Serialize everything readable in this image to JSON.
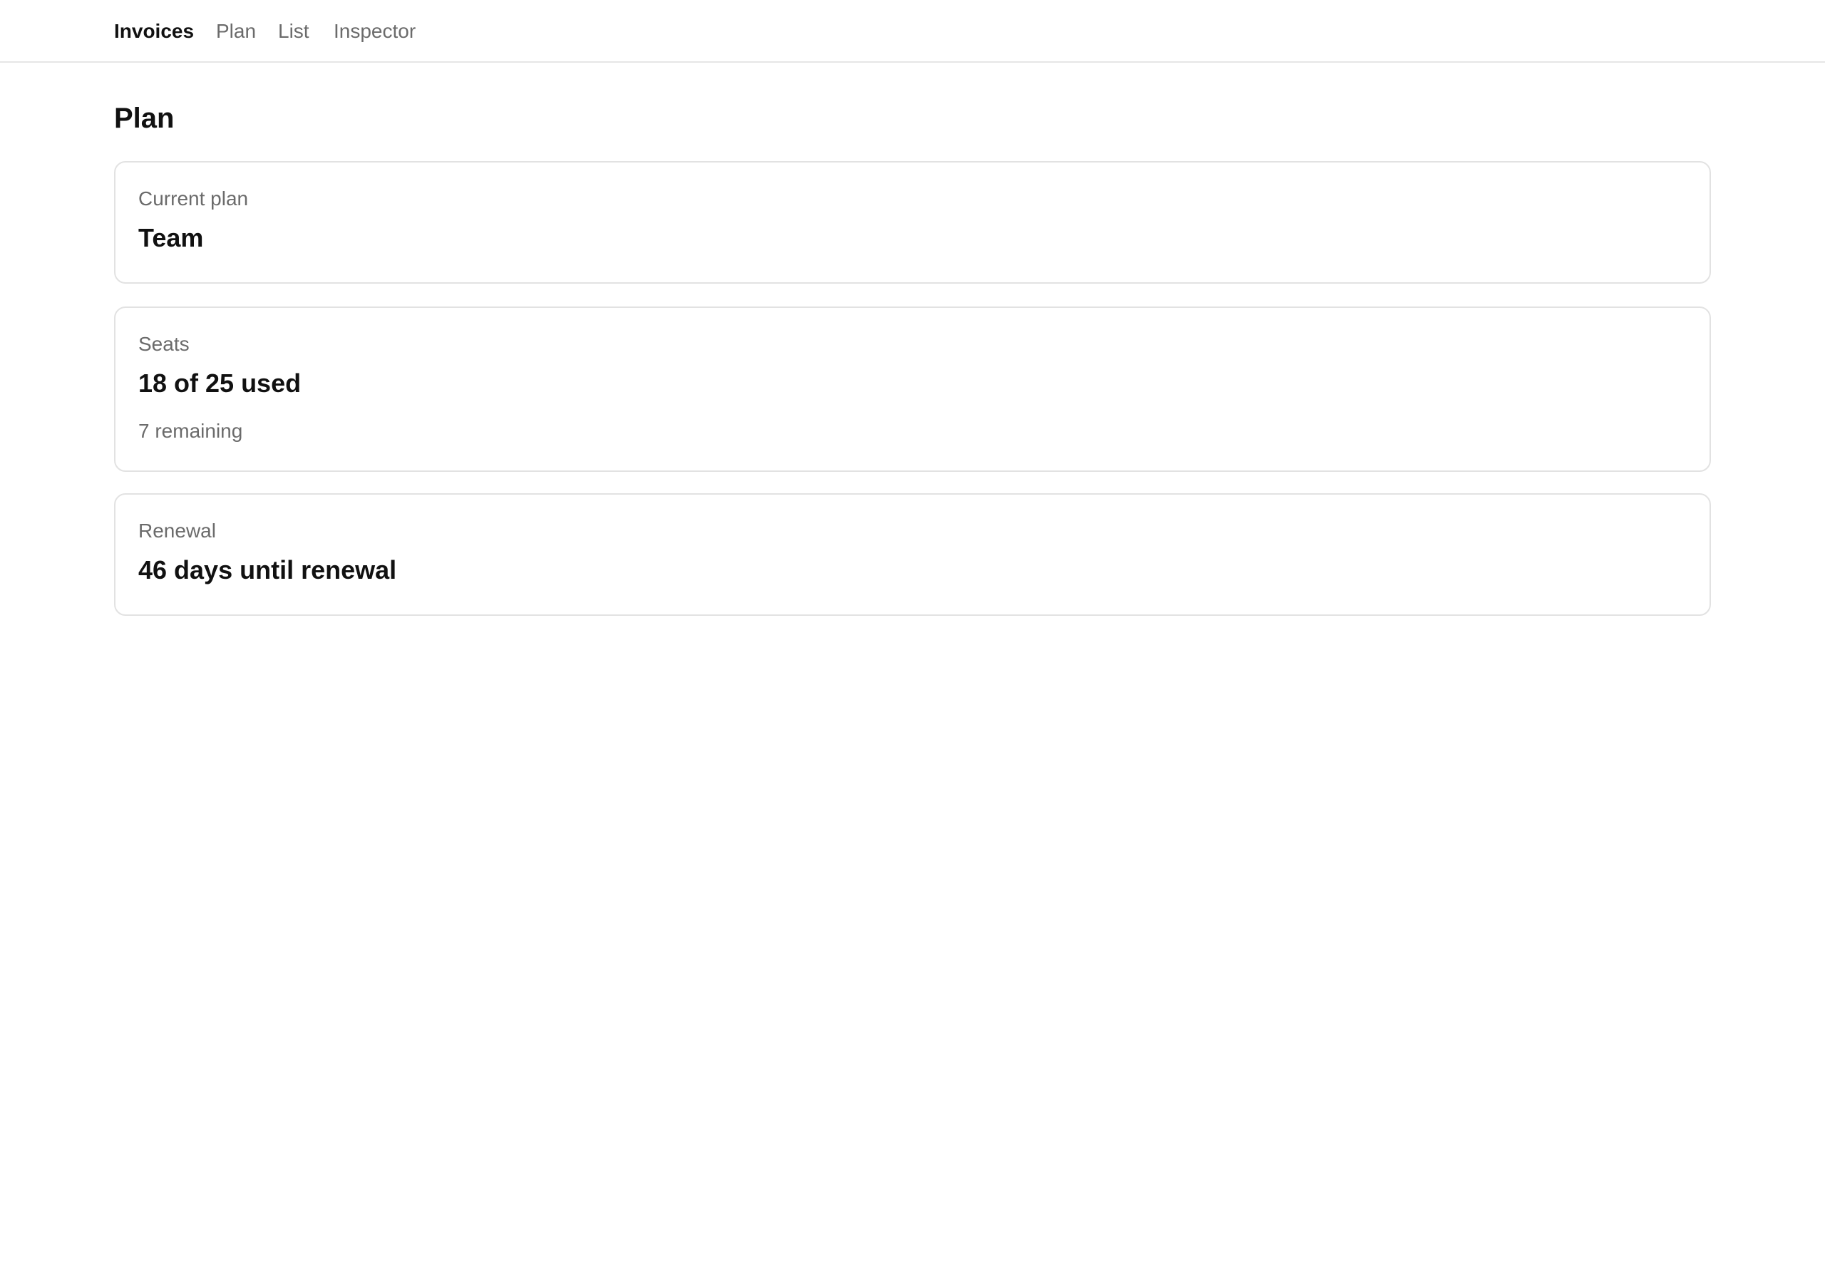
{
  "nav": {
    "brand": "Invoices",
    "links": [
      "Plan",
      "List",
      "Inspector"
    ]
  },
  "page": {
    "title": "Plan"
  },
  "cards": {
    "plan": {
      "label": "Current plan",
      "value": "Team"
    },
    "seats": {
      "label": "Seats",
      "value": "18 of 25 used",
      "sub": "7 remaining",
      "used": 18,
      "total": 25
    },
    "renewal": {
      "label": "Renewal",
      "value": "46 days until renewal"
    }
  },
  "colors": {
    "text": "#111111",
    "muted": "#6b6b6b",
    "border": "#e2e2e2",
    "background": "#ffffff"
  }
}
